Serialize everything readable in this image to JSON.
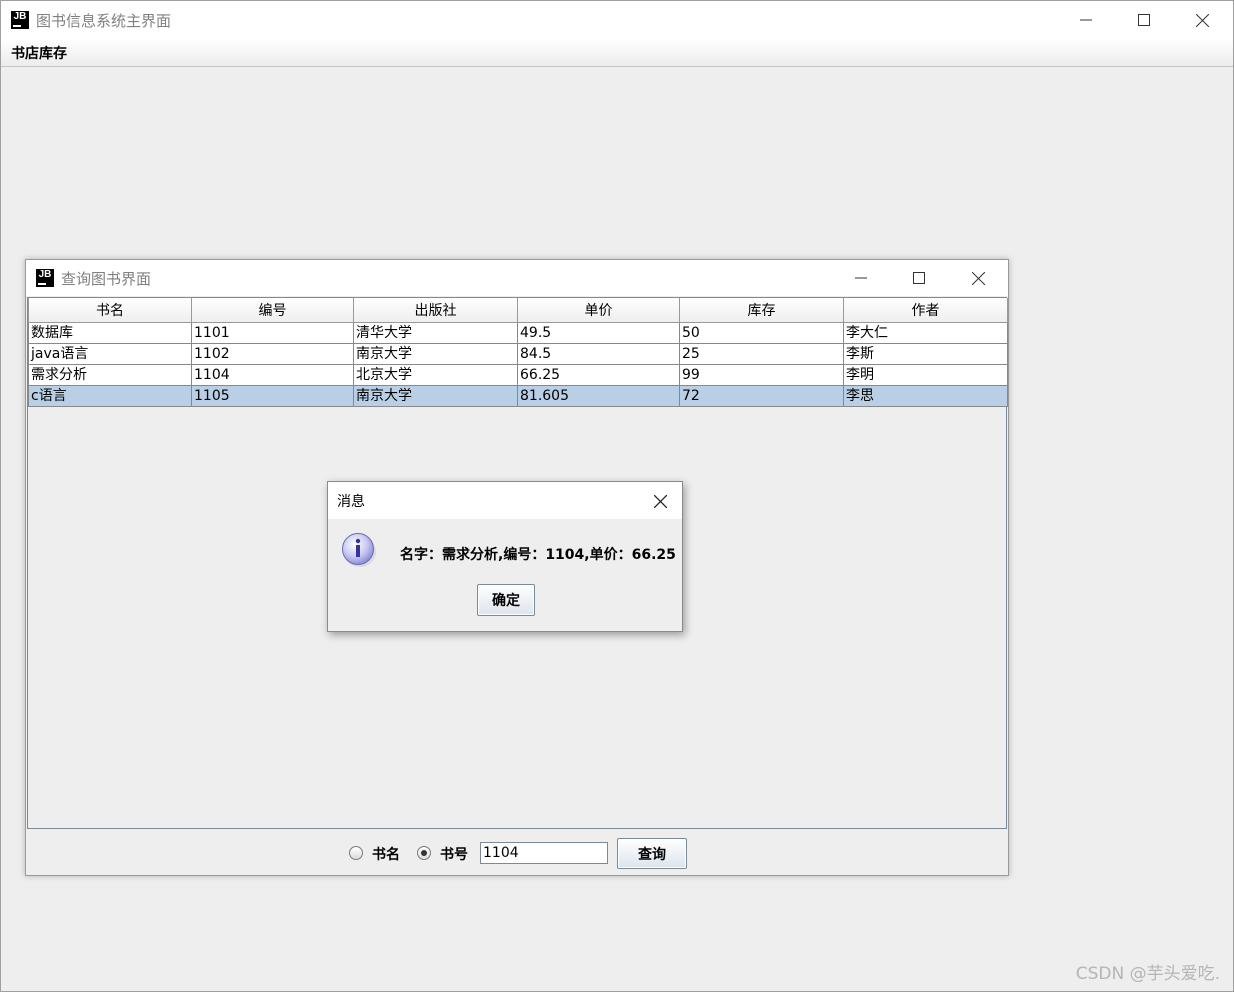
{
  "main_window": {
    "title": "图书信息系统主界面",
    "logo_text": "JB",
    "menu": {
      "items": [
        "书店库存"
      ]
    }
  },
  "query_window": {
    "title": "查询图书界面",
    "logo_text": "JB",
    "table": {
      "columns": [
        "书名",
        "编号",
        "出版社",
        "单价",
        "库存",
        "作者"
      ],
      "rows": [
        [
          "数据库",
          "1101",
          "清华大学",
          "49.5",
          "50",
          "李大仁"
        ],
        [
          "java语言",
          "1102",
          "南京大学",
          "84.5",
          "25",
          "李斯"
        ],
        [
          "需求分析",
          "1104",
          "北京大学",
          "66.25",
          "99",
          "李明"
        ],
        [
          "c语言",
          "1105",
          "南京大学",
          "81.605",
          "72",
          "李思"
        ]
      ],
      "selected_row": 3
    },
    "search": {
      "radio_name_label": "书名",
      "radio_id_label": "书号",
      "selected": "书号",
      "input_value": "1104",
      "button_label": "查询"
    }
  },
  "dialog": {
    "title": "消息",
    "message": "名字：需求分析,编号：1104,单价：66.25",
    "ok_label": "确定"
  },
  "watermark": "CSDN @芋头爱吃.",
  "colors": {
    "selection": "#b8cfe5",
    "title_text": "#808080",
    "background": "#eeeeee"
  }
}
